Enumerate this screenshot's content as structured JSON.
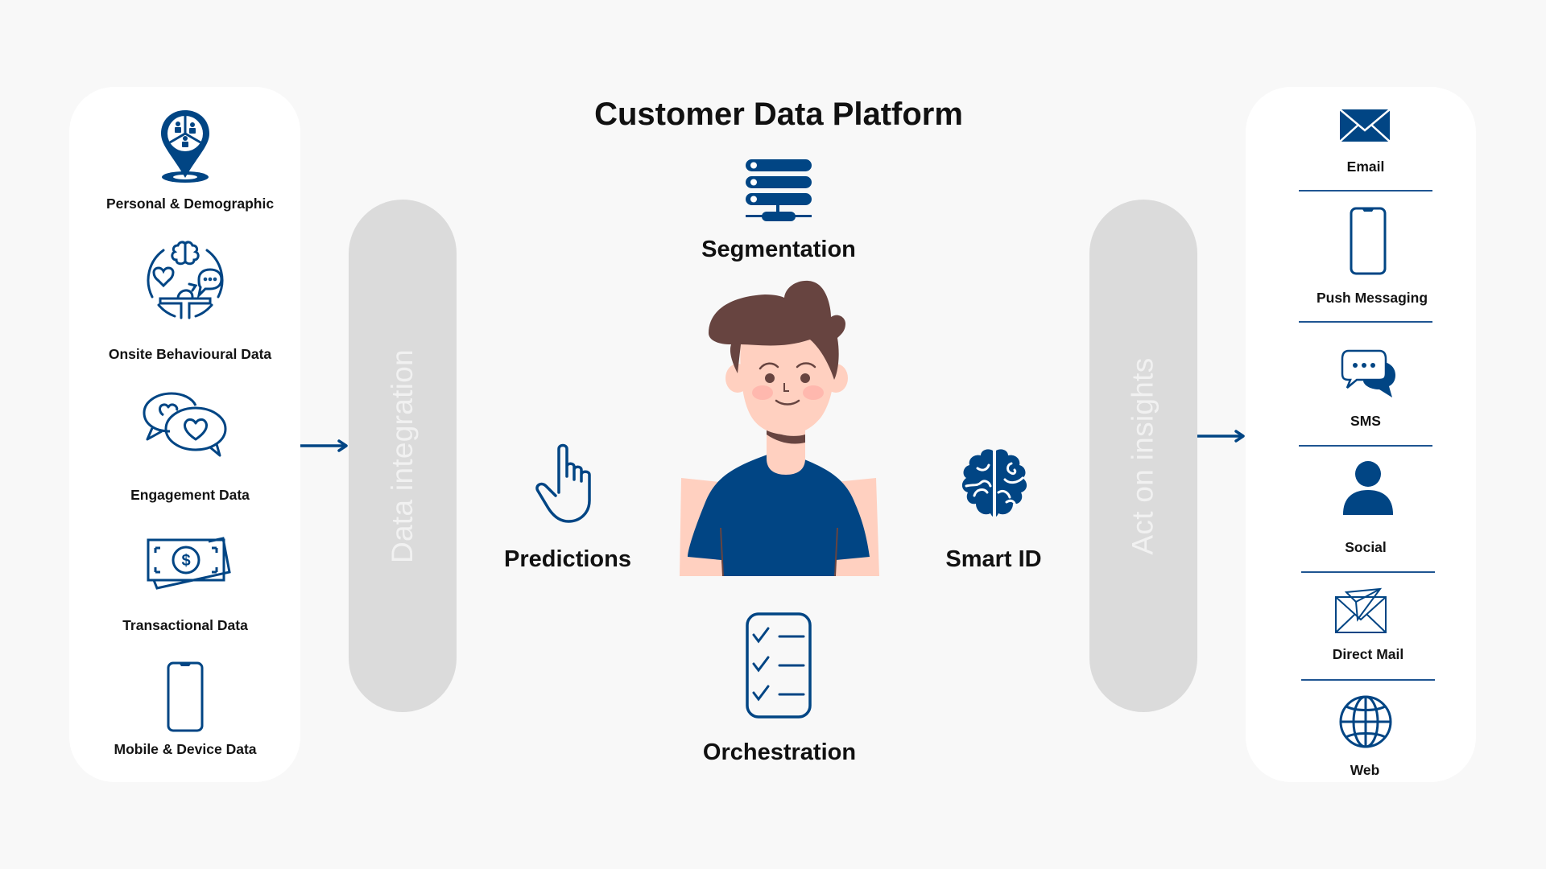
{
  "title": "Customer Data Platform",
  "colors": {
    "brand_blue": "#014584",
    "pill_gray": "#dbdbdb",
    "pill_text": "#f1f1f1",
    "hair": "#674440",
    "skin": "#ffd0c0",
    "cheek": "#ffb8ae",
    "background": "#f8f8f8"
  },
  "data_sources": {
    "items": [
      {
        "label": "Personal & Demographic",
        "icon": "location-pin-people-icon"
      },
      {
        "label": "Onsite Behavioural Data",
        "icon": "behaviour-circle-icon"
      },
      {
        "label": "Engagement Data",
        "icon": "heart-chat-bubbles-icon"
      },
      {
        "label": "Transactional Data",
        "icon": "banknote-icon"
      },
      {
        "label": "Mobile & Device Data",
        "icon": "smartphone-icon"
      }
    ]
  },
  "stages": {
    "integration": "Data integration",
    "act": "Act on insights"
  },
  "capabilities": {
    "segmentation": {
      "label": "Segmentation",
      "icon": "server-stack-icon"
    },
    "predictions": {
      "label": "Predictions",
      "icon": "pointing-hand-icon"
    },
    "smart_id": {
      "label": "Smart ID",
      "icon": "brain-icon"
    },
    "orchestration": {
      "label": "Orchestration",
      "icon": "checklist-icon"
    },
    "center": {
      "icon": "customer-avatar"
    }
  },
  "channels": {
    "items": [
      {
        "label": "Email",
        "icon": "envelope-icon"
      },
      {
        "label": "Push Messaging",
        "icon": "smartphone-icon"
      },
      {
        "label": "SMS",
        "icon": "chat-bubbles-icon"
      },
      {
        "label": "Social",
        "icon": "person-icon"
      },
      {
        "label": "Direct Mail",
        "icon": "paper-plane-envelope-icon"
      },
      {
        "label": "Web",
        "icon": "globe-icon"
      }
    ]
  }
}
